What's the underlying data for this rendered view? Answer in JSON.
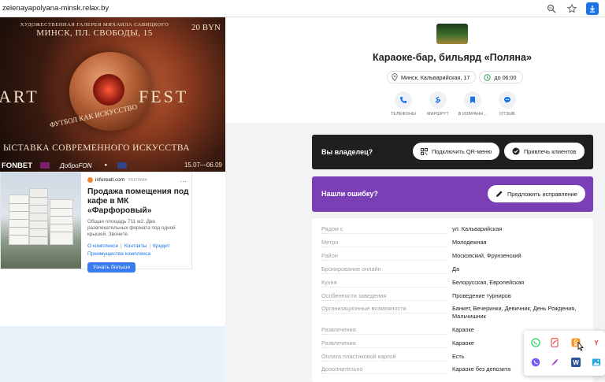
{
  "browser": {
    "url": "zelenayapolyana-minsk.relax.by"
  },
  "ad_banner": {
    "top_line": "ХУДОЖЕСТВЕННАЯ ГАЛЕРЕЯ МИХАИЛА САВИЦКОГО",
    "address": "МИНСК, ПЛ. СВОБОДЫ, 15",
    "price": "20 BYN",
    "word_left": "ART",
    "word_right": "FEST",
    "ball_caption": "ФУТБОЛ КАК ИСКУССТВО",
    "subtitle": "ЫСТАВКА СОВРЕМЕННОГО ИСКУССТВА",
    "sponsor_1": "FONBET",
    "sponsor_2": "ДоброFON",
    "dates": "15.07—06.09"
  },
  "ad_card": {
    "source": "inforealt.com",
    "source_tag": "РЕКЛАМА",
    "menu": "···",
    "title": "Продажа помещения под кафе в МК «Фарфоровый»",
    "text": "Общая площадь 711 м2. Два развлекательных формата под одной крышей. Звоните.",
    "links": [
      "О комплексе",
      "Контакты",
      "Кредит",
      "Преимущества комплекса"
    ],
    "button": "Узнать больше"
  },
  "place": {
    "title": "Караоке-бар, бильярд «Поляна»",
    "address": "Минск, Кальварийская, 17",
    "hours": "до 06:00",
    "actions": [
      {
        "label": "ТЕЛЕФОНЫ",
        "icon": "phone-icon"
      },
      {
        "label": "МАРШРУТ",
        "icon": "route-icon"
      },
      {
        "label": "В ИЗБРАНН...",
        "icon": "bookmark-icon"
      },
      {
        "label": "ОТЗЫВ",
        "icon": "chat-icon"
      }
    ]
  },
  "owner_block": {
    "label": "Вы владелец?",
    "qr_button": "Подключить QR-меню",
    "clients_button": "Привлечь клиентов"
  },
  "error_block": {
    "label": "Нашли ошибку?",
    "suggest_button": "Предложить исправление"
  },
  "details": [
    {
      "key": "Рядом с",
      "value": "ул. Кальварийская"
    },
    {
      "key": "Метро",
      "value": "Молодежная"
    },
    {
      "key": "Район",
      "value": "Московский, Фрунзенский"
    },
    {
      "key": "Бронирование онлайн",
      "value": "Да"
    },
    {
      "key": "Кухня",
      "value": "Белорусская, Европейская"
    },
    {
      "key": "Особенности заведения",
      "value": "Проведение турниров"
    },
    {
      "key": "Организационные возможности",
      "value": "Банкет, Вечеринки, Девичник, День Рождения, Мальчишник"
    },
    {
      "key": "Развлечения",
      "value": "Караоке"
    },
    {
      "key": "Развлечения",
      "value": "Караоке"
    },
    {
      "key": "Оплата пластиковой картой",
      "value": "Есть"
    },
    {
      "key": "Дополнительно",
      "value": "Караоке без депозита"
    }
  ],
  "share_panel": {
    "yandex_letter": "Y",
    "word_letter": "W"
  },
  "colors": {
    "owner_bg": "#1f1f1f",
    "error_bg": "#7b3fb5",
    "accent_blue": "#1a73e8",
    "ad_button": "#3a7bef"
  }
}
